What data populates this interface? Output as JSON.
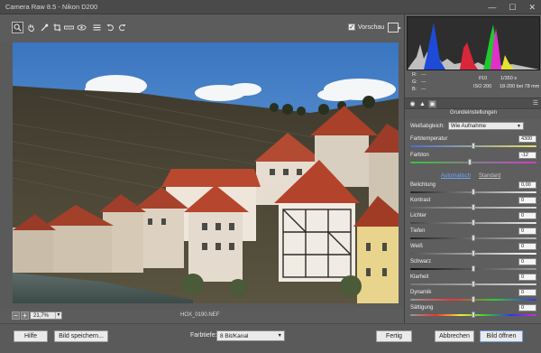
{
  "window": {
    "title": "Camera Raw 8.5 - Nikon D200",
    "minimize": "—",
    "maximize": "☐",
    "close": "✕"
  },
  "toolbar": {
    "tools": [
      {
        "name": "zoom-tool",
        "glyph": "🔍"
      },
      {
        "name": "hand-tool",
        "glyph": "✋"
      },
      {
        "name": "eyedropper-tool",
        "glyph": "✎"
      },
      {
        "name": "color-sampler-tool",
        "glyph": "✜"
      },
      {
        "name": "crop-tool",
        "glyph": "⌗"
      },
      {
        "name": "straighten-tool",
        "glyph": "⊟"
      },
      {
        "name": "redeye-tool",
        "glyph": "◉"
      },
      {
        "name": "list-tool",
        "glyph": "☰"
      },
      {
        "name": "rotate-left-tool",
        "glyph": "↺"
      },
      {
        "name": "rotate-right-tool",
        "glyph": "↻"
      }
    ],
    "preview_label": "Vorschau",
    "preview_checked": true
  },
  "info": {
    "r_label": "R:",
    "g_label": "G:",
    "b_label": "B:",
    "r_value": "---",
    "g_value": "---",
    "b_value": "---",
    "aperture": "f/10",
    "shutter": "1/350 s",
    "iso": "ISO 200",
    "lens": "18-200 bei 78 mm"
  },
  "panel": {
    "section_title": "Grundeinstellungen",
    "wb_label": "Weißabgleich:",
    "wb_value": "Wie Aufnahme",
    "temp_label": "Farbtemperatur",
    "temp_value": "4300",
    "tint_label": "Farbton",
    "tint_value": "-12",
    "auto_label": "Automatisch",
    "standard_label": "Standard",
    "sliders": [
      {
        "label": "Belichtung",
        "value": "0,00"
      },
      {
        "label": "Kontrast",
        "value": "0"
      },
      {
        "label": "Lichter",
        "value": "0"
      },
      {
        "label": "Tiefen",
        "value": "0"
      },
      {
        "label": "Weiß",
        "value": "0"
      },
      {
        "label": "Schwarz",
        "value": "0"
      },
      {
        "label": "Klarheit",
        "value": "0"
      },
      {
        "label": "Dynamik",
        "value": "0"
      },
      {
        "label": "Sättigung",
        "value": "0"
      }
    ]
  },
  "bottombar": {
    "zoom_value": "21,7%",
    "filename": "HOX_0190.NEF"
  },
  "footer": {
    "help_label": "Hilfe",
    "save_label": "Bild speichern...",
    "depth_label": "Farbtiefe:",
    "depth_value": "8 Bit/Kanal",
    "done_label": "Fertig",
    "cancel_label": "Abbrechen",
    "open_label": "Bild öffnen"
  },
  "colors": {
    "accent_link": "#6ea7ff",
    "temp_gradient": [
      "#4a6cd4",
      "#e8e060"
    ],
    "tint_gradient": [
      "#3cc23c",
      "#d03cd0"
    ]
  }
}
